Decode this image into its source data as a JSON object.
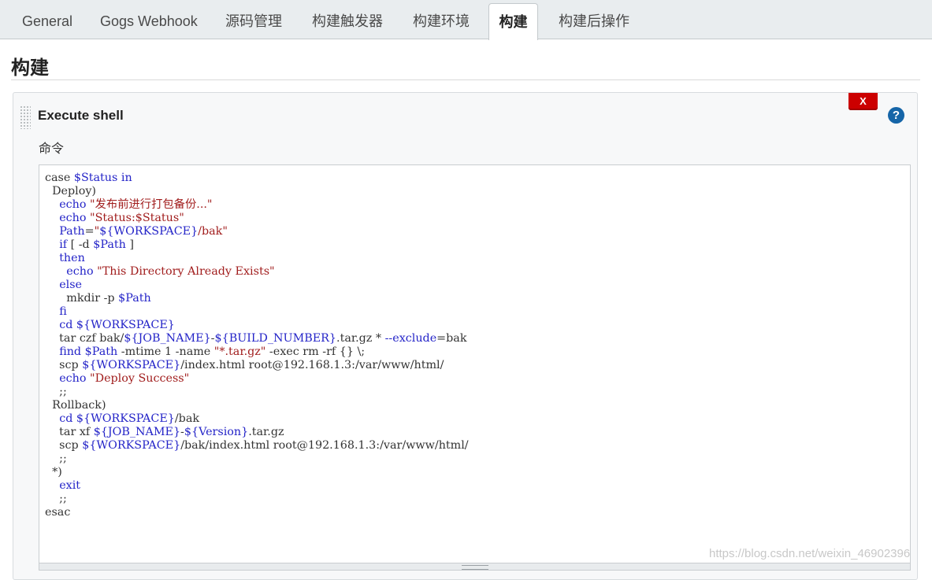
{
  "tabs": [
    {
      "label": "General",
      "active": false
    },
    {
      "label": "Gogs Webhook",
      "active": false
    },
    {
      "label": "源码管理",
      "active": false
    },
    {
      "label": "构建触发器",
      "active": false
    },
    {
      "label": "构建环境",
      "active": false
    },
    {
      "label": "构建",
      "active": true
    },
    {
      "label": "构建后操作",
      "active": false
    }
  ],
  "section": {
    "title": "构建"
  },
  "build_step": {
    "title": "Execute shell",
    "delete_label": "X",
    "help_label": "?",
    "command_label": "命令",
    "command_lines": [
      [
        {
          "t": "plain",
          "v": "case "
        },
        {
          "t": "var",
          "v": "$Status"
        },
        {
          "t": "plain",
          "v": " "
        },
        {
          "t": "kw",
          "v": "in"
        }
      ],
      [
        {
          "t": "plain",
          "v": "  Deploy)"
        }
      ],
      [
        {
          "t": "plain",
          "v": "    "
        },
        {
          "t": "kw",
          "v": "echo"
        },
        {
          "t": "plain",
          "v": " "
        },
        {
          "t": "str",
          "v": "\"发布前进行打包备份...\""
        }
      ],
      [
        {
          "t": "plain",
          "v": "    "
        },
        {
          "t": "kw",
          "v": "echo"
        },
        {
          "t": "plain",
          "v": " "
        },
        {
          "t": "str",
          "v": "\"Status:$Status\""
        }
      ],
      [
        {
          "t": "plain",
          "v": "    "
        },
        {
          "t": "var",
          "v": "Path"
        },
        {
          "t": "plain",
          "v": "="
        },
        {
          "t": "str",
          "v": "\""
        },
        {
          "t": "var",
          "v": "${WORKSPACE}"
        },
        {
          "t": "str",
          "v": "/bak\""
        }
      ],
      [
        {
          "t": "plain",
          "v": "    "
        },
        {
          "t": "kw",
          "v": "if"
        },
        {
          "t": "plain",
          "v": " [ -d "
        },
        {
          "t": "var",
          "v": "$Path"
        },
        {
          "t": "plain",
          "v": " ]"
        }
      ],
      [
        {
          "t": "plain",
          "v": "    "
        },
        {
          "t": "kw",
          "v": "then"
        }
      ],
      [
        {
          "t": "plain",
          "v": "      "
        },
        {
          "t": "kw",
          "v": "echo"
        },
        {
          "t": "plain",
          "v": " "
        },
        {
          "t": "str",
          "v": "\"This Directory Already Exists\""
        }
      ],
      [
        {
          "t": "plain",
          "v": "    "
        },
        {
          "t": "kw",
          "v": "else"
        }
      ],
      [
        {
          "t": "plain",
          "v": "      mkdir -p "
        },
        {
          "t": "var",
          "v": "$Path"
        }
      ],
      [
        {
          "t": "plain",
          "v": "    "
        },
        {
          "t": "kw",
          "v": "fi"
        }
      ],
      [
        {
          "t": "plain",
          "v": "    "
        },
        {
          "t": "kw",
          "v": "cd"
        },
        {
          "t": "plain",
          "v": " "
        },
        {
          "t": "var",
          "v": "${WORKSPACE}"
        }
      ],
      [
        {
          "t": "plain",
          "v": "    tar czf bak/"
        },
        {
          "t": "var",
          "v": "${JOB_NAME}"
        },
        {
          "t": "plain",
          "v": "-"
        },
        {
          "t": "var",
          "v": "${BUILD_NUMBER}"
        },
        {
          "t": "plain",
          "v": ".tar.gz * "
        },
        {
          "t": "kw",
          "v": "--exclude"
        },
        {
          "t": "plain",
          "v": "=bak"
        }
      ],
      [
        {
          "t": "plain",
          "v": "    "
        },
        {
          "t": "kw",
          "v": "find"
        },
        {
          "t": "plain",
          "v": " "
        },
        {
          "t": "var",
          "v": "$Path"
        },
        {
          "t": "plain",
          "v": " -mtime 1 -name "
        },
        {
          "t": "str",
          "v": "\"*.tar.gz\""
        },
        {
          "t": "plain",
          "v": " -exec rm -rf {} \\;"
        }
      ],
      [
        {
          "t": "plain",
          "v": "    scp "
        },
        {
          "t": "var",
          "v": "${WORKSPACE}"
        },
        {
          "t": "plain",
          "v": "/index.html root@192.168.1.3:/var/www/html/"
        }
      ],
      [
        {
          "t": "plain",
          "v": "    "
        },
        {
          "t": "kw",
          "v": "echo"
        },
        {
          "t": "plain",
          "v": " "
        },
        {
          "t": "str",
          "v": "\"Deploy Success\""
        }
      ],
      [
        {
          "t": "plain",
          "v": "    ;;"
        }
      ],
      [
        {
          "t": "plain",
          "v": "  Rollback)"
        }
      ],
      [
        {
          "t": "plain",
          "v": "    "
        },
        {
          "t": "kw",
          "v": "cd"
        },
        {
          "t": "plain",
          "v": " "
        },
        {
          "t": "var",
          "v": "${WORKSPACE}"
        },
        {
          "t": "plain",
          "v": "/bak"
        }
      ],
      [
        {
          "t": "plain",
          "v": "    tar xf "
        },
        {
          "t": "var",
          "v": "${JOB_NAME}"
        },
        {
          "t": "plain",
          "v": "-"
        },
        {
          "t": "var",
          "v": "${Version}"
        },
        {
          "t": "plain",
          "v": ".tar.gz"
        }
      ],
      [
        {
          "t": "plain",
          "v": "    scp "
        },
        {
          "t": "var",
          "v": "${WORKSPACE}"
        },
        {
          "t": "plain",
          "v": "/bak/index.html root@192.168.1.3:/var/www/html/"
        }
      ],
      [
        {
          "t": "plain",
          "v": "    ;;"
        }
      ],
      [
        {
          "t": "plain",
          "v": "  *)"
        }
      ],
      [
        {
          "t": "plain",
          "v": "    "
        },
        {
          "t": "kw",
          "v": "exit"
        }
      ],
      [
        {
          "t": "plain",
          "v": "    ;;"
        }
      ],
      [
        {
          "t": "plain",
          "v": "esac"
        }
      ]
    ]
  },
  "watermark": "https://blog.csdn.net/weixin_46902396",
  "colors": {
    "tabbar_bg": "#e9edef",
    "delete_red": "#cc0000",
    "help_blue": "#1565a8",
    "keyword_blue": "#2424c8",
    "string_red": "#a11d1d"
  }
}
